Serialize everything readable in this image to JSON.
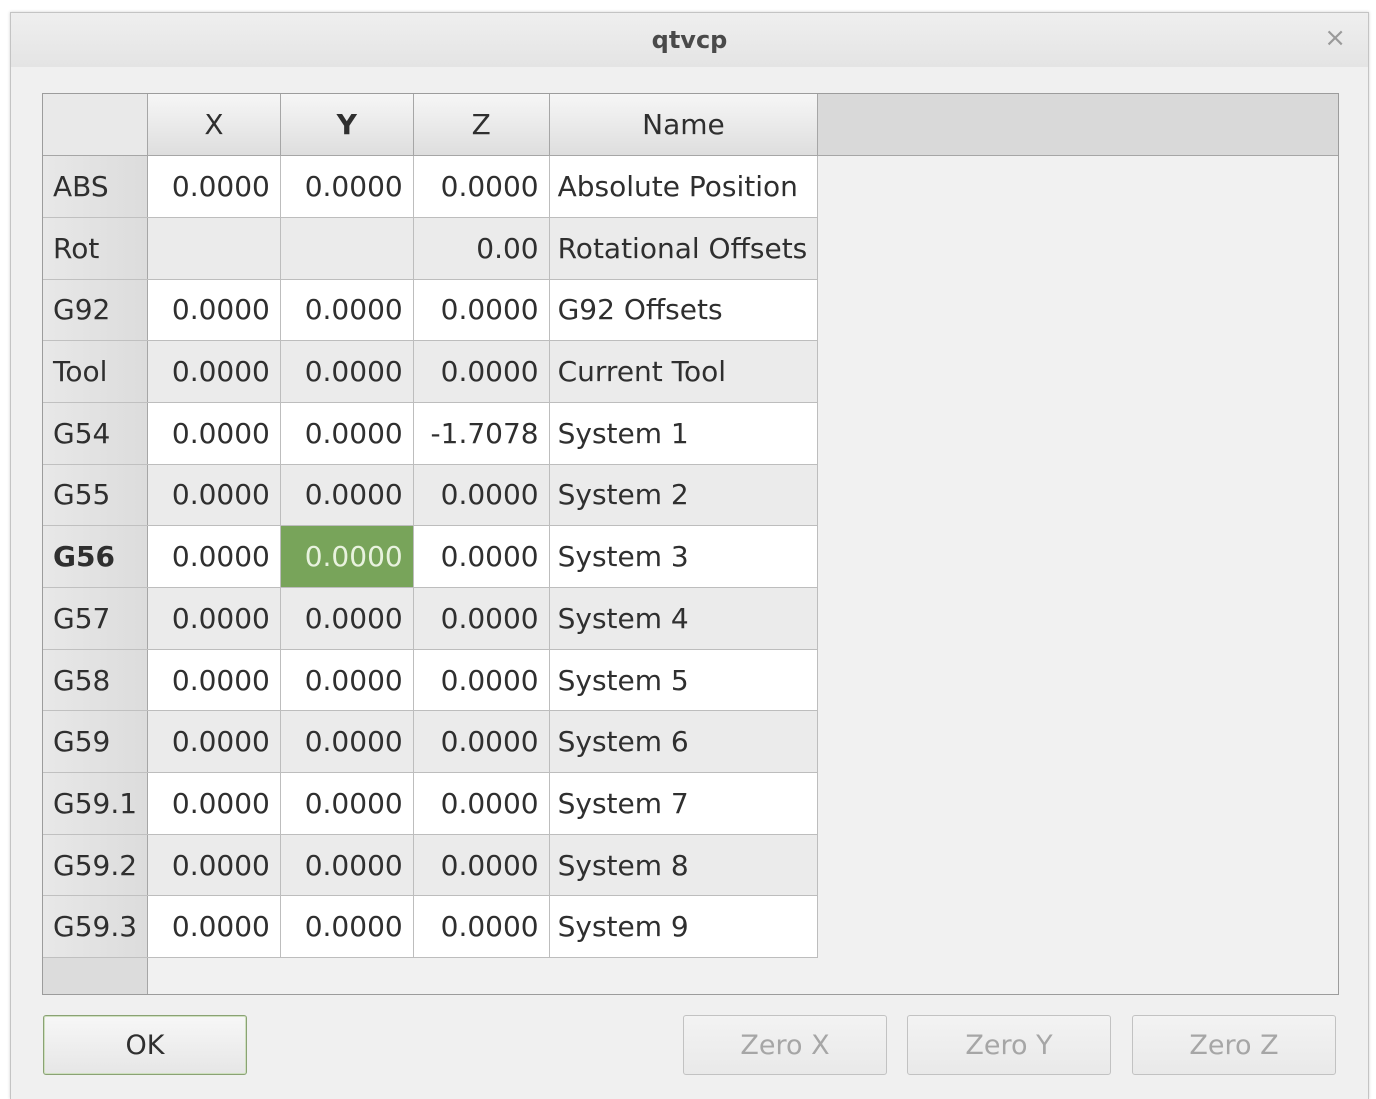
{
  "window": {
    "title": "qtvcp",
    "close_glyph": "×"
  },
  "table": {
    "columns": [
      "X",
      "Y",
      "Z",
      "Name"
    ],
    "rows": [
      {
        "label": "ABS",
        "x": "0.0000",
        "y": "0.0000",
        "z": "0.0000",
        "name": "Absolute Position"
      },
      {
        "label": "Rot",
        "x": "",
        "y": "",
        "z": "0.00",
        "name": "Rotational Offsets"
      },
      {
        "label": "G92",
        "x": "0.0000",
        "y": "0.0000",
        "z": "0.0000",
        "name": "G92 Offsets"
      },
      {
        "label": "Tool",
        "x": "0.0000",
        "y": "0.0000",
        "z": "0.0000",
        "name": "Current Tool"
      },
      {
        "label": "G54",
        "x": "0.0000",
        "y": "0.0000",
        "z": "-1.7078",
        "name": "System 1"
      },
      {
        "label": "G55",
        "x": "0.0000",
        "y": "0.0000",
        "z": "0.0000",
        "name": "System 2"
      },
      {
        "label": "G56",
        "x": "0.0000",
        "y": "0.0000",
        "z": "0.0000",
        "name": "System 3"
      },
      {
        "label": "G57",
        "x": "0.0000",
        "y": "0.0000",
        "z": "0.0000",
        "name": "System 4"
      },
      {
        "label": "G58",
        "x": "0.0000",
        "y": "0.0000",
        "z": "0.0000",
        "name": "System 5"
      },
      {
        "label": "G59",
        "x": "0.0000",
        "y": "0.0000",
        "z": "0.0000",
        "name": "System 6"
      },
      {
        "label": "G59.1",
        "x": "0.0000",
        "y": "0.0000",
        "z": "0.0000",
        "name": "System 7"
      },
      {
        "label": "G59.2",
        "x": "0.0000",
        "y": "0.0000",
        "z": "0.0000",
        "name": "System 8"
      },
      {
        "label": "G59.3",
        "x": "0.0000",
        "y": "0.0000",
        "z": "0.0000",
        "name": "System 9"
      }
    ],
    "selected_row": "G56",
    "selected_column": "Y",
    "selection_color": "#78a45a"
  },
  "buttons": {
    "ok": "OK",
    "zero_x": "Zero X",
    "zero_y": "Zero Y",
    "zero_z": "Zero Z"
  }
}
